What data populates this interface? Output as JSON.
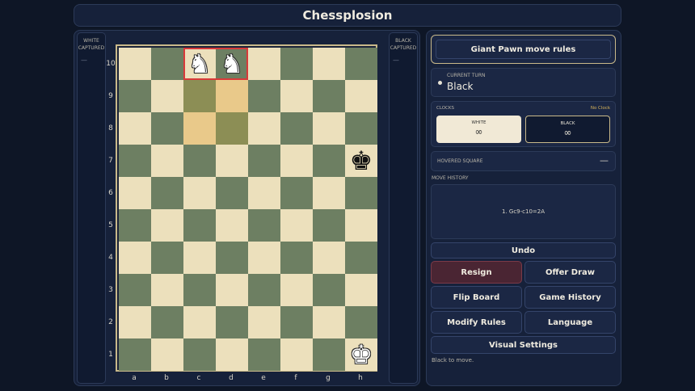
{
  "app": {
    "title": "Chessplosion"
  },
  "captured": {
    "white_title": "WHITE CAPTURED",
    "white_value": "—",
    "black_title": "BLACK CAPTURED",
    "black_value": "—"
  },
  "board": {
    "ranks": [
      "10",
      "9",
      "8",
      "7",
      "6",
      "5",
      "4",
      "3",
      "2",
      "1"
    ],
    "files": [
      "a",
      "b",
      "c",
      "d",
      "e",
      "f",
      "g",
      "h"
    ],
    "pieces": [
      {
        "square": "c10",
        "piece": "knight",
        "color": "white",
        "glyph": "♞"
      },
      {
        "square": "d10",
        "piece": "knight",
        "color": "white",
        "glyph": "♞"
      },
      {
        "square": "h7",
        "piece": "king",
        "color": "black",
        "glyph": "♚"
      },
      {
        "square": "h1",
        "piece": "king",
        "color": "white",
        "glyph": "♚"
      }
    ],
    "highlighted_squares": [
      "c9",
      "d9",
      "c8",
      "d8"
    ],
    "giant_piece_squares": [
      "c10",
      "d10"
    ],
    "colors": {
      "light": "#ece0bc",
      "dark": "#6d7f62",
      "highlight": "#d83a3a"
    }
  },
  "sidebar": {
    "rules_button": "Giant Pawn move rules",
    "turn_label": "CURRENT TURN",
    "turn_value": "Black",
    "clocks_label": "CLOCKS",
    "clocks_mode": "No Clock",
    "clock_white_name": "WHITE",
    "clock_white_value": "∞",
    "clock_black_name": "BLACK",
    "clock_black_value": "∞",
    "hover_label": "HOVERED SQUARE",
    "hover_value": "—",
    "history_label": "MOVE HISTORY",
    "history_text": "1. Gc9-c10=2A",
    "undo": "Undo",
    "resign": "Resign",
    "offer_draw": "Offer Draw",
    "flip_board": "Flip Board",
    "game_history": "Game History",
    "modify_rules": "Modify Rules",
    "language": "Language",
    "visual_settings": "Visual Settings",
    "status": "Black to move."
  }
}
